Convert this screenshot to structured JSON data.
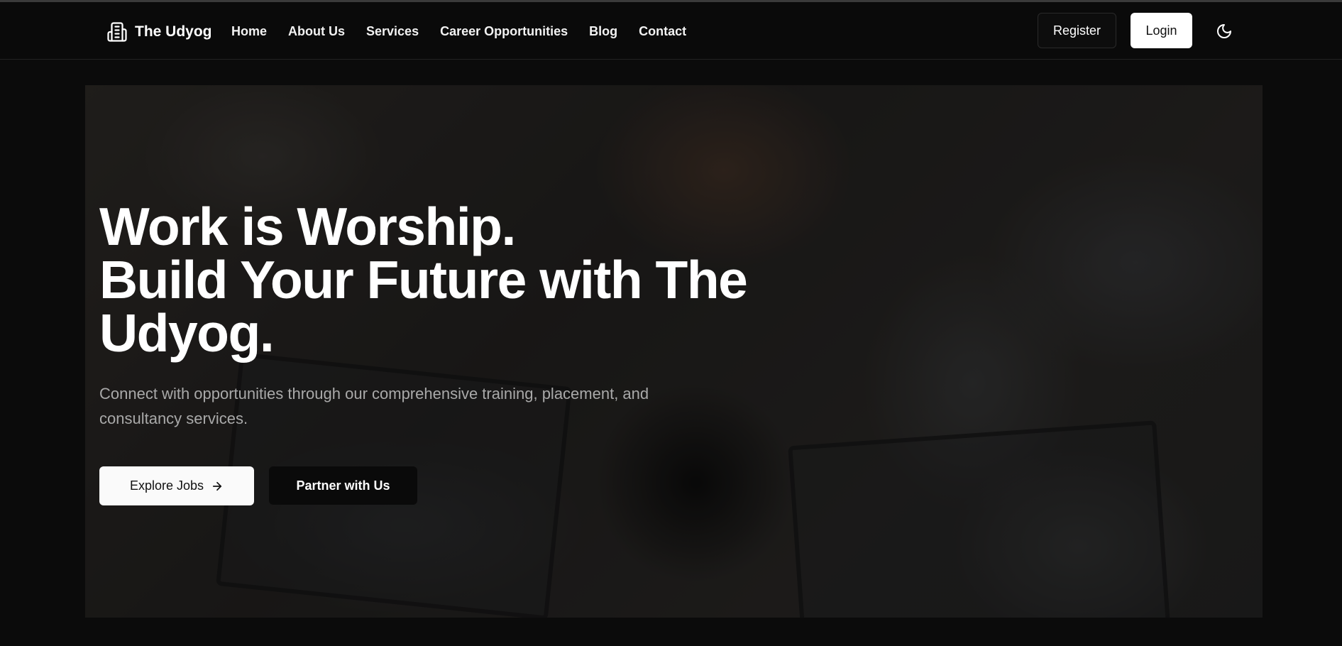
{
  "brand": {
    "name": "The Udyog",
    "logo_icon": "building-icon"
  },
  "nav": {
    "links": [
      "Home",
      "About Us",
      "Services",
      "Career Opportunities",
      "Blog",
      "Contact"
    ]
  },
  "auth": {
    "register_label": "Register",
    "login_label": "Login"
  },
  "theme_toggle_icon": "moon-icon",
  "hero": {
    "title_lines": [
      "Work is Worship.",
      "Build Your Future with The",
      "Udyog."
    ],
    "subtitle": "Connect with opportunities through our comprehensive training, placement, and consultancy services.",
    "explore_label": "Explore Jobs",
    "explore_icon": "arrow-right-icon",
    "partner_label": "Partner with Us",
    "background": "blurred office photo of people working on laptops"
  },
  "colors": {
    "background": "#0b0b0b",
    "primary_button": "#ffffff",
    "secondary_button": "#0a0a0a",
    "subtitle_text": "#a9a9a9"
  }
}
